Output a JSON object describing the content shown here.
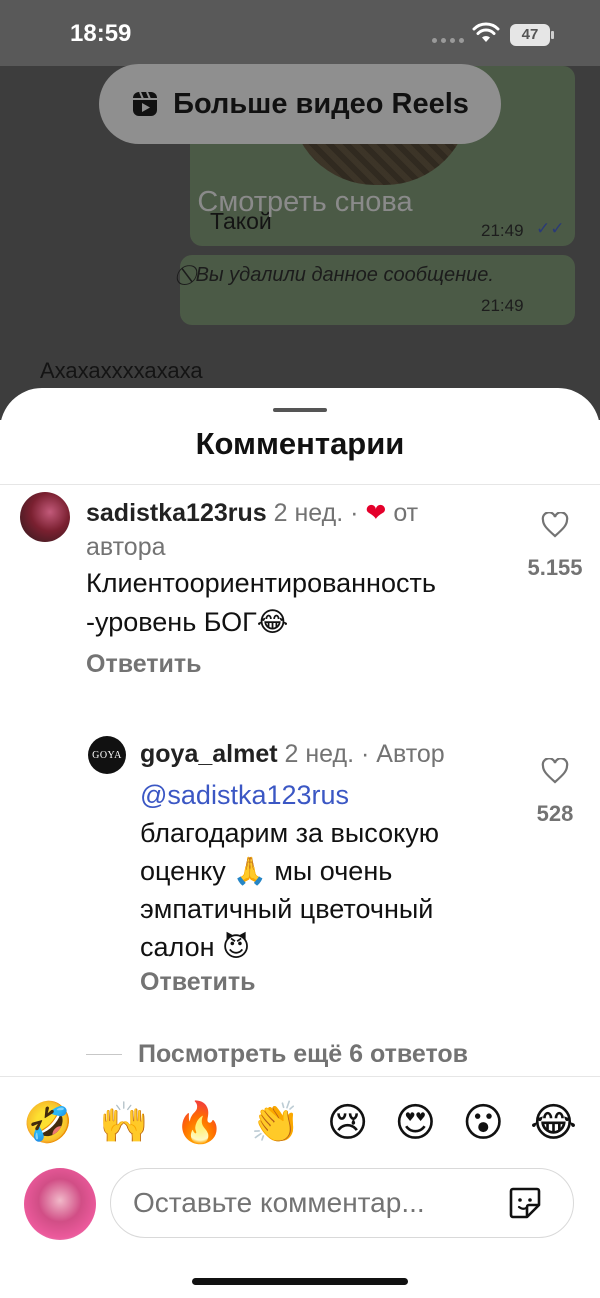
{
  "status_bar": {
    "time": "18:59",
    "battery": "47"
  },
  "background": {
    "messages": {
      "takoi": "Такой",
      "time_1": "21:49",
      "deleted": "Вы удалили данное сообщение.",
      "time_2": "21:49",
      "laugh": "Ахахаххххахаха"
    },
    "watch_again": "Смотреть снова",
    "reels_button": "Больше видео Reels"
  },
  "sheet": {
    "title": "Комментарии",
    "comments": [
      {
        "username": "sadistka123rus",
        "age": "2 нед.",
        "separator": "·",
        "by_author": "от автора",
        "text": "Клиентоориентированность -уровень БОГ😂",
        "reply_label": "Ответить",
        "likes": "5.155"
      },
      {
        "username": "goya_almet",
        "age": "2 нед.",
        "separator": "·",
        "author_badge": "Автор",
        "avatar_text": "GOYA",
        "mention": "@sadistka123rus",
        "text": "благодарим за высокую оценку 🙏 мы очень эмпатичный цветочный салон 😈",
        "reply_label": "Ответить",
        "likes": "528"
      }
    ],
    "more_replies": "Посмотреть ещё 6 ответов"
  },
  "emoji_bar": [
    "🤣",
    "🙌",
    "🔥",
    "👏",
    "😢",
    "😍",
    "😮",
    "😂"
  ],
  "comment_input": {
    "placeholder": "Оставьте комментар..."
  },
  "colors": {
    "heart": "#e4002b",
    "mention": "#3b57c4",
    "muted": "#737373"
  },
  "icons": [
    "wifi-icon",
    "reels-icon",
    "heart-outline-icon",
    "sticker-icon"
  ]
}
